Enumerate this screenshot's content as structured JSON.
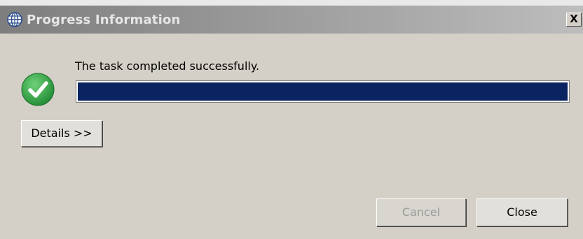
{
  "window": {
    "title": "Progress Information",
    "title_icon": "globe-icon",
    "close_glyph": "X"
  },
  "status": {
    "icon": "check-circle-icon",
    "message": "The task completed successfully.",
    "progress": 1.0
  },
  "buttons": {
    "details_label": "Details >>",
    "cancel_label": "Cancel",
    "cancel_enabled": false,
    "close_label": "Close"
  },
  "colors": {
    "progress_fill": "#0a2462",
    "success_green": "#2e9e3e",
    "dialog_background": "#d4d0c8"
  }
}
